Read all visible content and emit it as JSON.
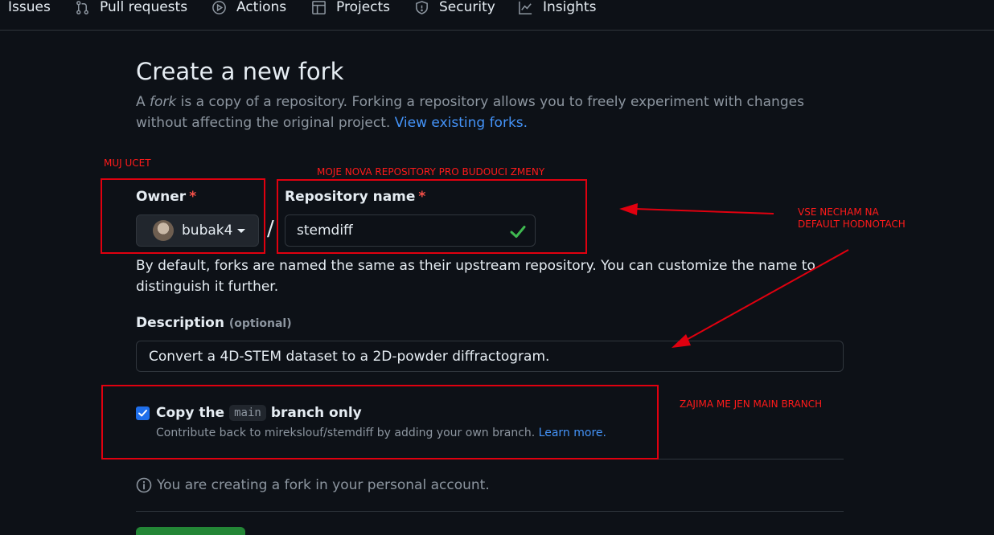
{
  "nav": {
    "tabs": [
      {
        "label": "Issues",
        "icon": "issue-icon"
      },
      {
        "label": "Pull requests",
        "icon": "pull-request-icon"
      },
      {
        "label": "Actions",
        "icon": "play-icon"
      },
      {
        "label": "Projects",
        "icon": "table-icon"
      },
      {
        "label": "Security",
        "icon": "shield-icon"
      },
      {
        "label": "Insights",
        "icon": "graph-icon"
      }
    ]
  },
  "page": {
    "title": "Create a new fork",
    "subtitle_prefix": "A ",
    "subtitle_em": "fork",
    "subtitle_text": " is a copy of a repository. Forking a repository allows you to freely experiment with changes without affecting the original project. ",
    "subtitle_link": "View existing forks."
  },
  "form": {
    "owner_label": "Owner",
    "required_mark": "*",
    "owner_value": "bubak4",
    "separator": "/",
    "repo_label": "Repository name",
    "repo_value": "stemdiff",
    "name_help": "By default, forks are named the same as their upstream repository. You can customize the name to distinguish it further.",
    "description_label": "Description",
    "description_optional": "(optional)",
    "description_value": "Convert a 4D-STEM dataset to a 2D-powder diffractogram.",
    "copy_checked": true,
    "copy_label_before": "Copy the",
    "copy_code": "main",
    "copy_label_after": "branch only",
    "copy_note": "Contribute back to mirekslouf/stemdiff by adding your own branch.",
    "copy_note_link": "Learn more.",
    "info_text": "You are creating a fork in your personal account."
  },
  "annotations": {
    "owner_note": "MUJ UCET",
    "repo_note": "MOJE NOVA REPOSITORY PRO BUDOUCI ZMENY",
    "defaults_note_line1": "VSE NECHAM NA",
    "defaults_note_line2": "DEFAULT HODNOTACH",
    "branch_note": "ZAJIMA ME JEN MAIN BRANCH",
    "color": "#e0000f"
  },
  "colors": {
    "background": "#0d1117",
    "link": "#4493f8",
    "required": "#f85149",
    "checkbox": "#1f6feb",
    "success": "#3fb950"
  }
}
